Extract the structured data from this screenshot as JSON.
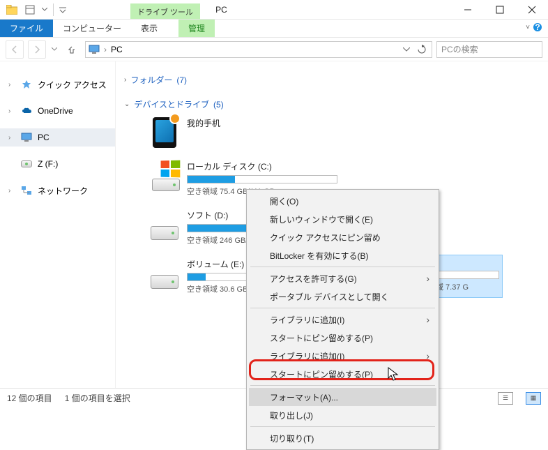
{
  "window": {
    "contextual_tab": "ドライブ ツール",
    "title": "PC"
  },
  "ribbon": {
    "file": "ファイル",
    "computer": "コンピューター",
    "view": "表示",
    "manage": "管理"
  },
  "address": {
    "location": "PC",
    "search_placeholder": "PCの検索"
  },
  "nav": {
    "quick_access": "クイック アクセス",
    "onedrive": "OneDrive",
    "pc": "PC",
    "z_drive": "Z (F:)",
    "network": "ネットワーク"
  },
  "groups": {
    "folders": {
      "label": "フォルダー",
      "count": "(7)"
    },
    "devices": {
      "label": "デバイスとドライブ",
      "count": "(5)"
    }
  },
  "devices": {
    "phone": {
      "name": "我的手机"
    },
    "c": {
      "name": "ローカル ディスク (C:)",
      "sub": "空き領域 75.4 GB/111 GB",
      "fill": 32
    },
    "d": {
      "name": "ソフト (D:)",
      "sub": "空き領域 246 GB/430 GB",
      "fill": 43
    },
    "e": {
      "name": "ボリューム (E:)",
      "sub": "空き領域 30.6 GB/34.8 GB",
      "fill": 12
    },
    "f": {
      "name": "Z (F:)",
      "sub": "空き領域 7.37 G",
      "fill": 8
    }
  },
  "context_menu": {
    "open": "開く(O)",
    "open_new": "新しいウィンドウで開く(E)",
    "pin_quick": "クイック アクセスにピン留め",
    "bitlocker": "BitLocker を有効にする(B)",
    "grant_access": "アクセスを許可する(G)",
    "portable": "ポータブル デバイスとして開く",
    "add_library": "ライブラリに追加(I)",
    "pin_start1": "スタートにピン留めする(P)",
    "add_library2": "ライブラリに追加(I)",
    "pin_start2": "スタートにピン留めする(P)",
    "format": "フォーマット(A)...",
    "cut": "取り出し(J)",
    "cut2": "切り取り(T)"
  },
  "status": {
    "items": "12 個の項目",
    "selected": "1 個の項目を選択"
  }
}
